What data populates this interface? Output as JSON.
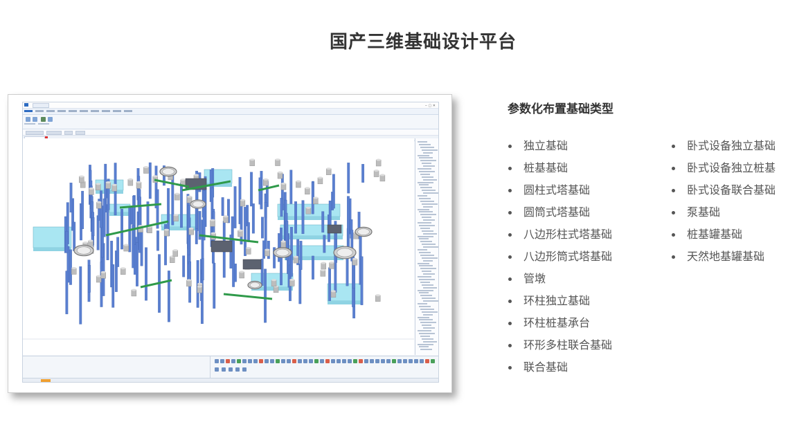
{
  "page": {
    "title": "国产三维基础设计平台",
    "subtitle": "参数化布置基础类型"
  },
  "foundation_types": {
    "column1": [
      "独立基础",
      "桩基基础",
      "圆柱式塔基础",
      "圆筒式塔基础",
      "八边形柱式塔基础",
      "八边形筒式塔基础",
      "管墩",
      "环柱独立基础",
      "环柱桩基承台",
      "环形多柱联合基础",
      "联合基础"
    ],
    "column2": [
      "卧式设备独立基础",
      "卧式设备独立桩基",
      "卧式设备联合基础",
      "泵基础",
      "桩基罐基础",
      "天然地基罐基础"
    ]
  },
  "colors": {
    "heading": "#333333",
    "list_text": "#555555",
    "pile_blue": "#5a7fd0",
    "pedestal_grey": "#bdbdbd",
    "cap_cyan": "#a9e6f2",
    "beam_green": "#2f9a4a",
    "app_accent": "#2c6bc2"
  },
  "icons": {
    "bullet": "bullet-dot-icon",
    "app_logo": "app-logo-icon"
  }
}
